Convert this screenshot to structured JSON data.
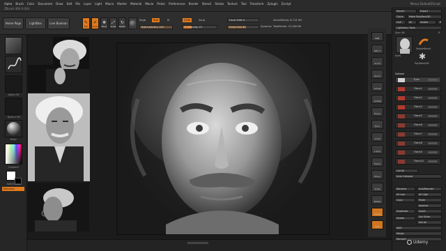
{
  "menubar": {
    "items": [
      "Alpha",
      "Brush",
      "Color",
      "Document",
      "Draw",
      "Edit",
      "File",
      "Layer",
      "Light",
      "Macro",
      "Marker",
      "Material",
      "Movie",
      "Picker",
      "Preferences",
      "Render",
      "Stencil",
      "Stroke",
      "Texture",
      "Tool",
      "Transform",
      "Zplugin",
      "Zscript"
    ],
    "subtitle": "ZBrush 4R6 0.034",
    "right": "Menus   DefaultZScript"
  },
  "toolbar": {
    "home_page": "Home Page",
    "lightbox": "LightBox",
    "live_boolean": "Live Boolean",
    "tools": [
      {
        "label": "Edit",
        "active": true,
        "glyph": "✎"
      },
      {
        "label": "Draw",
        "active": true,
        "glyph": "✐"
      },
      {
        "label": "Move",
        "active": false,
        "glyph": "✥"
      },
      {
        "label": "Scale",
        "active": false,
        "glyph": "⤢"
      },
      {
        "label": "Rotate",
        "active": false,
        "glyph": "↻"
      }
    ],
    "mrgb": "Mrgb",
    "rgb": "Rgb",
    "m": "M",
    "zadd": "Zadd",
    "zsub": "Zsub",
    "rgb_intensity": "Rgb Intensity 100",
    "z_intensity": "Z Intensity 25",
    "focal_shift": "Focal Shift 0",
    "draw_size": "Draw Size 64",
    "dynamic": "Dynamic",
    "active_points": "ActivePoints: 8.714 Mil",
    "total_points": "TotalPoints: 13.180 Mil"
  },
  "lefttray": {
    "alpha_label": "Alpha Off",
    "texture_label": "Texture Off",
    "material_label": "Basic",
    "gradient_label": "Gradient",
    "switch_color": "SwitchColor",
    "alternate": "Alternate"
  },
  "rightshelf": {
    "buttons": [
      "BPR",
      "SPix 3",
      "Scroll",
      "Zoom",
      "Actual",
      "AAHalf",
      "Persp",
      "Floor",
      "Local",
      "L.Sym",
      "Frame",
      "Move",
      "Scale",
      "Rotate",
      "Transp",
      "Solo"
    ]
  },
  "rightpanel": {
    "import": "Import",
    "export": "Export",
    "clone": "Clone",
    "make_polymesh": "Make PolyMesh3D",
    "goz": "GoZ",
    "all": "All",
    "visible": "Visible",
    "r": "R",
    "lightbox_tools": "Lightbox ▸ Tools",
    "sync_label": "Sync 46",
    "r2": "R",
    "tool_names": [
      "Eyes",
      "SimpleBrush",
      "PolyMesh3D"
    ],
    "subtool_header": "Subtool",
    "subtools": [
      "Eyes",
      "Fibers1",
      "Fibers2",
      "Fibers3",
      "Fibers5",
      "Fibers6",
      "Fibers7",
      "Fibers8",
      "Fibers9",
      "Fibers10"
    ],
    "list_all": "List All",
    "auto_collapse": "Auto Collapse",
    "rename": "Rename",
    "autoreorder": "AutoReorder",
    "all_low": "All Low",
    "all_high": "All High",
    "copy": "Copy",
    "paste": "Paste",
    "append": "Append",
    "duplicate": "Duplicate",
    "insert": "Insert",
    "delete": "Delete",
    "del_other": "Del Other",
    "del_all": "Del All",
    "split": "Split",
    "merge": "Merge",
    "remesh": "Remesh"
  },
  "watermark": "Udemy",
  "colors": {
    "accent": "#e07a1e",
    "panel": "#242424",
    "bg": "#1b1b1b"
  }
}
